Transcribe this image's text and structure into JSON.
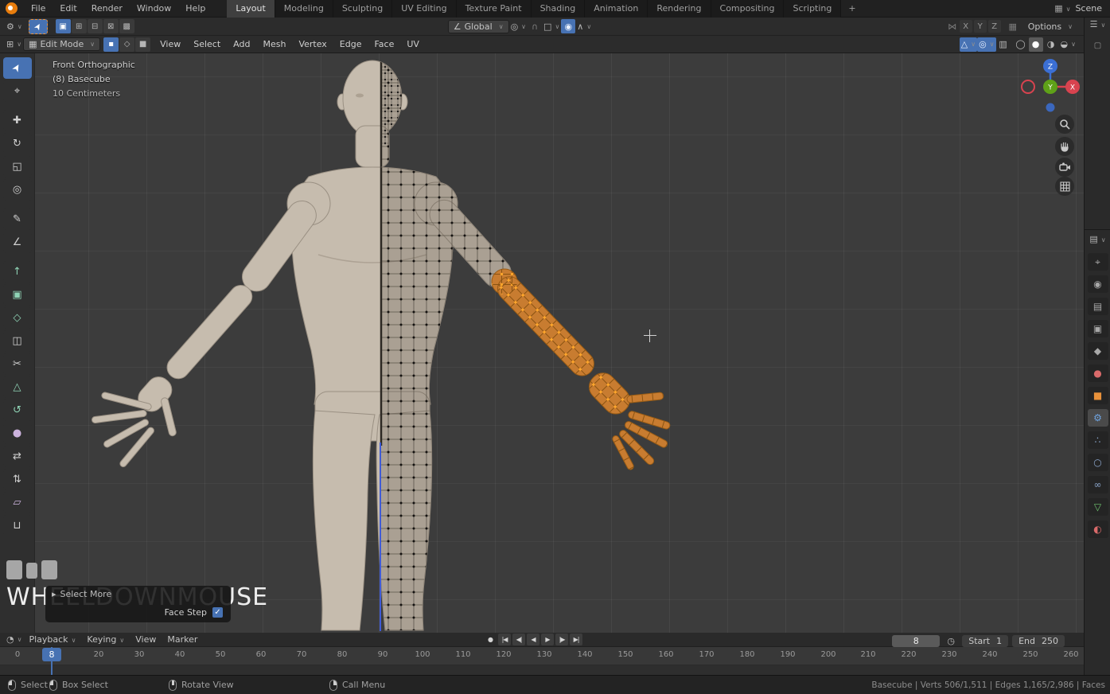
{
  "colors": {
    "accent_blue": "#4772b3",
    "selection_orange": "#ff9a2e",
    "skin": "#c6bcae",
    "viewport_bg": "#3c3c3c",
    "header_bg": "#2c2c2c"
  },
  "topbar": {
    "app_menus": [
      "File",
      "Edit",
      "Render",
      "Window",
      "Help"
    ],
    "workspaces": [
      "Layout",
      "Modeling",
      "Sculpting",
      "UV Editing",
      "Texture Paint",
      "Shading",
      "Animation",
      "Rendering",
      "Compositing",
      "Scripting"
    ],
    "active_workspace": "Layout",
    "add_tab": "+",
    "scene_icon": "▦",
    "scene": "Scene"
  },
  "tool_settings": {
    "editor_icon": "⚙",
    "tool_icon": "➤",
    "select_mode_icons": [
      "▣",
      "⊞",
      "⊟",
      "⊠",
      "▩"
    ],
    "orientation_icon": "∠",
    "orientation": "Global",
    "pivot_icon": "◎",
    "magnet_icon": "∩",
    "snap_target_icon": "□",
    "proportional_icon": "◉",
    "falloff_icon": "∧",
    "mirror_icon": "⋈",
    "mirror_axes": [
      "X",
      "Y",
      "Z"
    ],
    "grid_icon": "▦",
    "options_label": "Options"
  },
  "vp_header": {
    "editor_icon": "⊞",
    "mode_icon": "▦",
    "mode_label": "Edit Mode",
    "select_modes": [
      "▪",
      "◇",
      "■"
    ],
    "menus": [
      "View",
      "Select",
      "Add",
      "Mesh",
      "Vertex",
      "Edge",
      "Face",
      "UV"
    ],
    "gizmo_icon": "△",
    "overlays_icon": "◎",
    "xray_icon": "▥",
    "shading_icons": [
      "◯",
      "●",
      "◑",
      "◒"
    ]
  },
  "viewport_overlay": {
    "line1": "Front Orthographic",
    "line2": "(8) Basecube",
    "line3": "10 Centimeters"
  },
  "toolbar_tools": [
    {
      "name": "select-box",
      "glyph": "➤"
    },
    {
      "name": "cursor",
      "glyph": "⌖"
    },
    {
      "name": "move",
      "glyph": "✚"
    },
    {
      "name": "rotate",
      "glyph": "↻"
    },
    {
      "name": "scale",
      "glyph": "◱"
    },
    {
      "name": "transform",
      "glyph": "◎"
    },
    {
      "name": "annotate",
      "glyph": "✎"
    },
    {
      "name": "measure",
      "glyph": "∠"
    },
    {
      "name": "extrude-region",
      "glyph": "↑"
    },
    {
      "name": "inset-faces",
      "glyph": "▣"
    },
    {
      "name": "bevel",
      "glyph": "◇"
    },
    {
      "name": "loop-cut",
      "glyph": "◫"
    },
    {
      "name": "knife",
      "glyph": "✂"
    },
    {
      "name": "poly-build",
      "glyph": "△"
    },
    {
      "name": "spin",
      "glyph": "↺"
    },
    {
      "name": "smooth",
      "glyph": "●"
    },
    {
      "name": "edge-slide",
      "glyph": "⇄"
    },
    {
      "name": "shrink-fatten",
      "glyph": "⇅"
    },
    {
      "name": "shear",
      "glyph": "▱"
    },
    {
      "name": "rip-region",
      "glyph": "⊔"
    }
  ],
  "gizmo": {
    "x": "X",
    "y": "Y",
    "z": "Z"
  },
  "right_strip": {
    "outliner_icon": "☰",
    "outliner_item_icon": "▢",
    "properties_icon": "▤",
    "tabs": [
      {
        "name": "tool",
        "glyph": "⌖"
      },
      {
        "name": "render",
        "glyph": "◉"
      },
      {
        "name": "output",
        "glyph": "▤"
      },
      {
        "name": "view-layer",
        "glyph": "▣"
      },
      {
        "name": "scene",
        "glyph": "◆"
      },
      {
        "name": "world",
        "glyph": "●"
      },
      {
        "name": "object",
        "glyph": "■"
      },
      {
        "name": "modifiers",
        "glyph": "⚙"
      },
      {
        "name": "particles",
        "glyph": "∴"
      },
      {
        "name": "physics",
        "glyph": "○"
      },
      {
        "name": "constraints",
        "glyph": "∞"
      },
      {
        "name": "object-data",
        "glyph": "▽"
      },
      {
        "name": "material",
        "glyph": "◐"
      }
    ]
  },
  "screencast": {
    "key_text": "WHEELDOWNMOUSE"
  },
  "operator_panel": {
    "expander": "▸",
    "title": "Select More",
    "option_label": "Face Step",
    "option_checked": true,
    "check_glyph": "✓"
  },
  "timeline": {
    "editor_icon": "◔",
    "menus": [
      "Playback",
      "Keying",
      "View",
      "Marker"
    ],
    "transport": [
      "●",
      "|◀",
      "◀|",
      "◀",
      "▶",
      "|▶",
      "▶|"
    ],
    "current_frame": "8",
    "start_label": "Start",
    "start_value": "1",
    "end_label": "End",
    "end_value": "250",
    "ruler_labels": [
      "0",
      "20",
      "30",
      "40",
      "50",
      "60",
      "70",
      "80",
      "90",
      "100",
      "110",
      "120",
      "130",
      "140",
      "150",
      "160",
      "170",
      "180",
      "190",
      "200",
      "210",
      "220",
      "230",
      "240",
      "250",
      "260"
    ]
  },
  "statusbar": {
    "hints": [
      "Select",
      "Box Select",
      "Rotate View",
      "Call Menu"
    ],
    "stats": "Basecube | Verts 506/1,511 | Edges 1,165/2,986 | Faces"
  }
}
